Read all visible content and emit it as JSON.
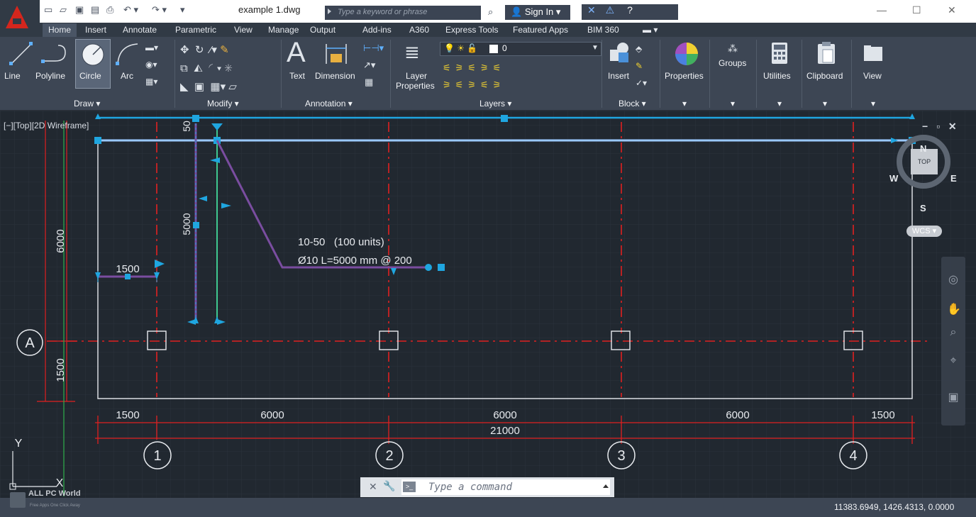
{
  "title_bar": {
    "document_title": "example 1.dwg",
    "search_placeholder": "Type a keyword or phrase",
    "sign_in_label": "Sign In",
    "help_label": "?",
    "minimize": "—",
    "maximize": "☐",
    "close": "✕"
  },
  "ribbon_tabs": [
    "Home",
    "Insert",
    "Annotate",
    "Parametric",
    "View",
    "Manage",
    "Output",
    "Add-ins",
    "A360",
    "Express Tools",
    "Featured Apps",
    "BIM 360"
  ],
  "draw_panel": {
    "title": "Draw ▾",
    "tools": [
      "Line",
      "Polyline",
      "Circle",
      "Arc"
    ]
  },
  "modify_panel": {
    "title": "Modify ▾"
  },
  "annotation_panel": {
    "title": "Annotation ▾",
    "tools": [
      "Text",
      "Dimension"
    ]
  },
  "layers_panel": {
    "title": "Layers ▾",
    "layer_properties_line1": "Layer",
    "layer_properties_line2": "Properties",
    "current_layer": "0"
  },
  "block_panel": {
    "title": "Block ▾",
    "insert_label": "Insert"
  },
  "right_tools": [
    "Properties",
    "Groups",
    "Utilities",
    "Clipboard",
    "View"
  ],
  "viewport": {
    "label": "[−][Top][2D Wireframe]",
    "window_controls": "− ▫ ✕"
  },
  "viewcube": {
    "face": "TOP",
    "north": "N",
    "south": "S",
    "east": "E",
    "west": "W",
    "ucs": "WCS ▾"
  },
  "drawing_text": {
    "grid_row": "A",
    "grid_cols": [
      "1",
      "2",
      "3",
      "4"
    ],
    "dim_bottom_segments": [
      "1500",
      "6000",
      "6000",
      "6000",
      "1500"
    ],
    "dim_bottom_total": "21000",
    "dim_left_6000": "6000",
    "dim_left_1500": "1500",
    "dim_5000": "5000",
    "dim_50": "50",
    "dim_1500_small": "1500",
    "rebar_line1": "10-50   (100 units)",
    "rebar_line2": "Ø10 L=5000 mm @ 200",
    "ucs_y": "Y",
    "ucs_x": "X"
  },
  "command_line": {
    "placeholder": "Type a command",
    "icon_label": ">_"
  },
  "status_bar": {
    "coordinates": "11383.6949, 1426.4313, 0.0000"
  },
  "watermark": {
    "title": "ALL PC World",
    "subtitle": "Free Apps One Click Away"
  },
  "colors": {
    "canvas_bg": "#212830",
    "ribbon_bg": "#3d4654",
    "grid_line_red": "#e02020",
    "selection_blue": "#1fa6e0",
    "rebar_purple": "#7a4da0",
    "rebar_green": "#3fc890"
  }
}
